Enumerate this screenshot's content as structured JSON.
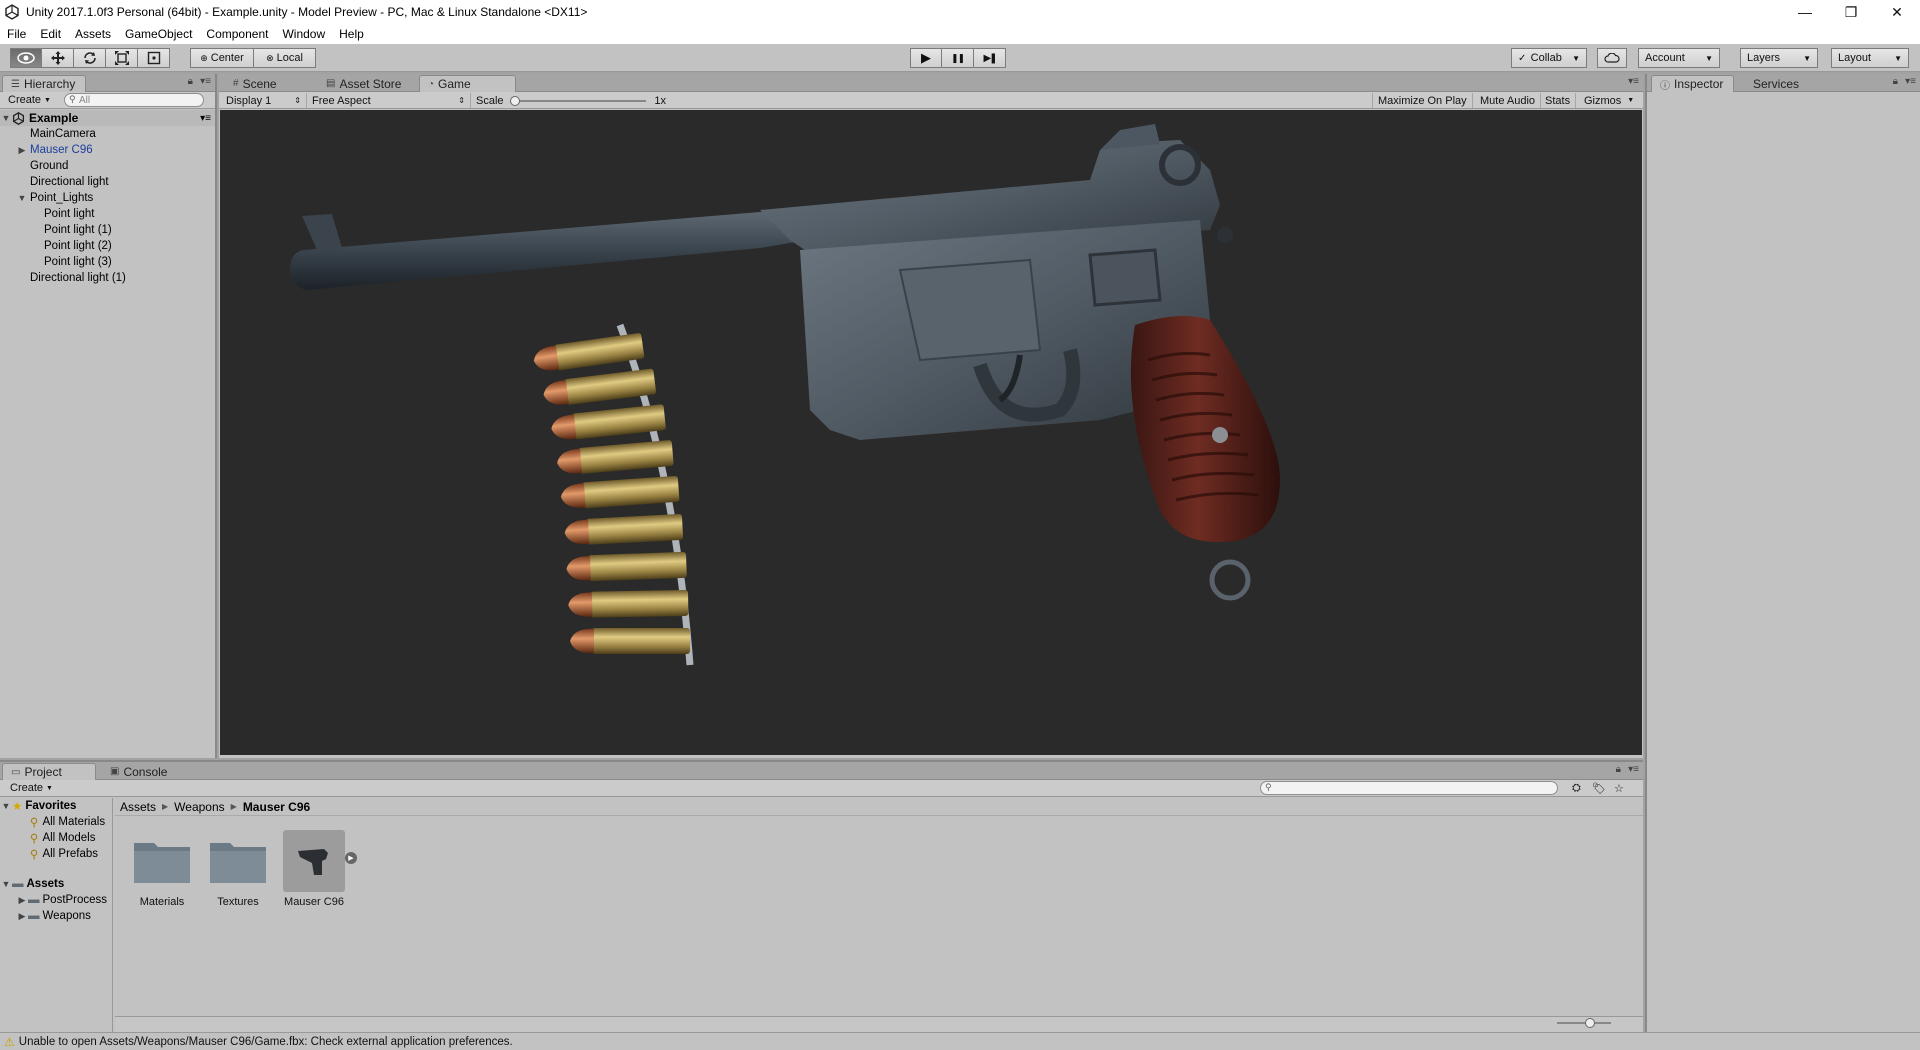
{
  "window": {
    "title": "Unity 2017.1.0f3 Personal (64bit) - Example.unity - Model Preview - PC, Mac & Linux Standalone <DX11>",
    "minimize": "—",
    "restore": "❐",
    "close": "✕"
  },
  "menu": [
    "File",
    "Edit",
    "Assets",
    "GameObject",
    "Component",
    "Window",
    "Help"
  ],
  "toolbar": {
    "tools": [
      "view-tool-icon",
      "move-tool-icon",
      "rotate-tool-icon",
      "scale-tool-icon",
      "rect-tool-icon"
    ],
    "pivot_mode": "Center",
    "pivot_rotation": "Local",
    "play": "▶",
    "pause": "❚❚",
    "step": "▶❚",
    "collab": "Collab",
    "account": "Account",
    "layers": "Layers",
    "layout": "Layout"
  },
  "hierarchy": {
    "tab": "Hierarchy",
    "create": "Create",
    "search_placeholder": "All",
    "scene": "Example",
    "items": [
      {
        "label": "MainCamera"
      },
      {
        "label": "Mauser C96"
      },
      {
        "label": "Ground"
      },
      {
        "label": "Directional light"
      },
      {
        "label": "Point_Lights"
      },
      {
        "label": "Point light"
      },
      {
        "label": "Point light (1)"
      },
      {
        "label": "Point light (2)"
      },
      {
        "label": "Point light (3)"
      },
      {
        "label": "Directional light (1)"
      }
    ]
  },
  "center_tabs": {
    "scene": "Scene",
    "asset_store": "Asset Store",
    "game": "Game"
  },
  "game_toolbar": {
    "display": "Display 1",
    "aspect": "Free Aspect",
    "scale_label": "Scale",
    "scale_value": "1x",
    "maximize": "Maximize On Play",
    "mute": "Mute Audio",
    "stats": "Stats",
    "gizmos": "Gizmos"
  },
  "inspector": {
    "tab": "Inspector",
    "services": "Services"
  },
  "project": {
    "tab": "Project",
    "console": "Console",
    "create": "Create",
    "favorites": "Favorites",
    "favorite_items": [
      "All Materials",
      "All Models",
      "All Prefabs"
    ],
    "assets": "Assets",
    "asset_folders": [
      "PostProcess",
      "Weapons"
    ],
    "breadcrumb": [
      "Assets",
      "Weapons",
      "Mauser C96"
    ],
    "tiles": [
      "Materials",
      "Textures",
      "Mauser C96"
    ]
  },
  "status": {
    "message": "Unable to open Assets/Weapons/Mauser C96/Game.fbx: Check external application preferences."
  }
}
